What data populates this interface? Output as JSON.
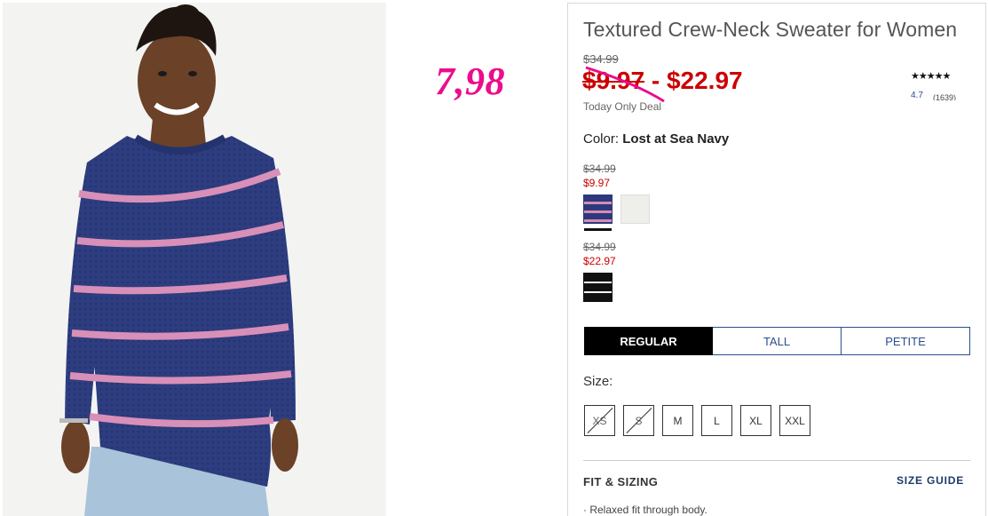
{
  "annotation": {
    "text": "7,98"
  },
  "product": {
    "title": "Textured Crew-Neck Sweater for Women",
    "original_price": "$34.99",
    "price_low": "$9.97",
    "price_separator": " - ",
    "price_high": "$22.97",
    "deal_label": "Today Only Deal",
    "rating": {
      "stars": "★★★★★",
      "value": "4.7",
      "count": "(1639)"
    },
    "color_label": "Color:",
    "color_name": "Lost at Sea Navy"
  },
  "swatch_groups": [
    {
      "original_price": "$34.99",
      "sale_price": "$9.97"
    },
    {
      "original_price": "$34.99",
      "sale_price": "$22.97"
    }
  ],
  "fit_tabs": [
    "REGULAR",
    "TALL",
    "PETITE"
  ],
  "size_label": "Size:",
  "sizes": [
    "XS",
    "S",
    "M",
    "L",
    "XL",
    "XXL"
  ],
  "details": {
    "fit_title": "FIT & SIZING",
    "size_guide": "SIZE GUIDE",
    "bullet_1": "·  Relaxed fit through body."
  },
  "colors": {
    "sale_red": "#cc0000",
    "annotation_pink": "#ec0c8c",
    "link_blue": "#1d3a6b"
  }
}
